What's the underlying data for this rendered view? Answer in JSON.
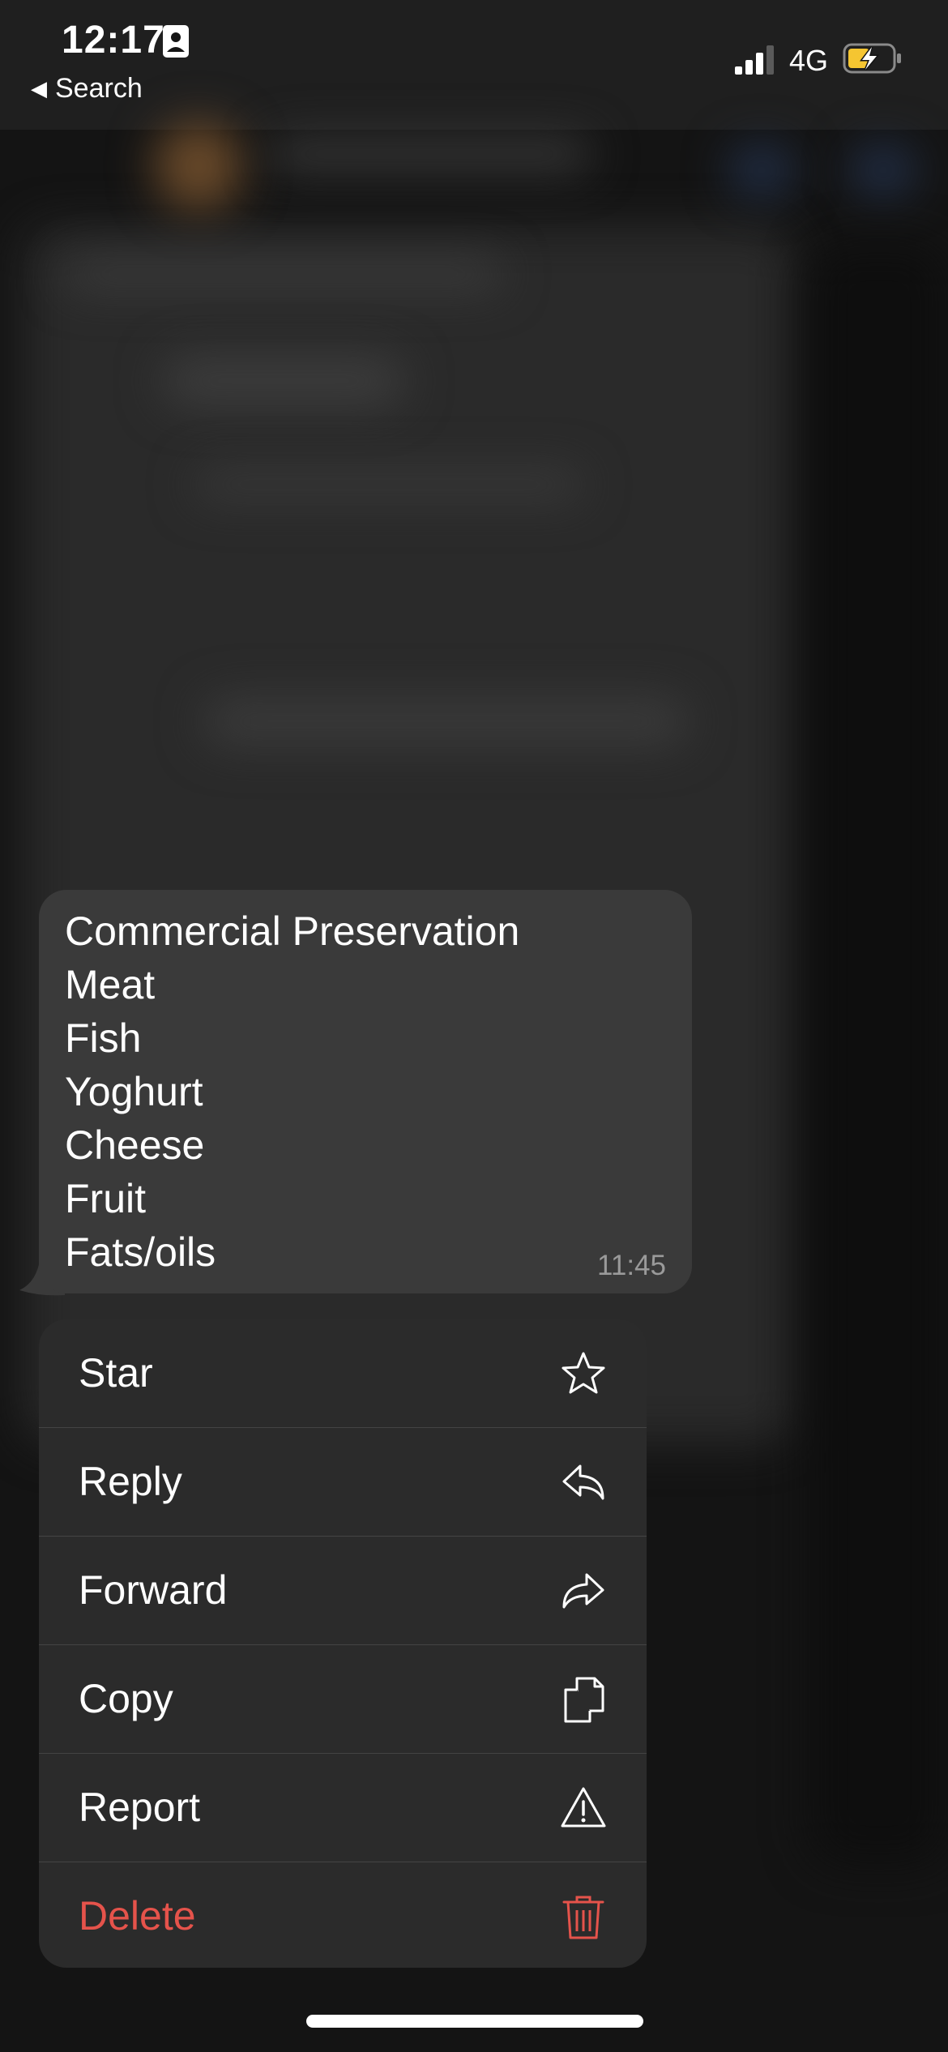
{
  "status_bar": {
    "time": "12:17",
    "back_label": "Search",
    "network": "4G"
  },
  "message": {
    "lines": [
      "Commercial Preservation",
      "Meat",
      "Fish",
      "Yoghurt",
      "Cheese",
      "Fruit",
      "Fats/oils"
    ],
    "time": "11:45"
  },
  "menu": {
    "items": [
      {
        "label": "Star",
        "icon": "star-icon"
      },
      {
        "label": "Reply",
        "icon": "reply-icon"
      },
      {
        "label": "Forward",
        "icon": "forward-icon"
      },
      {
        "label": "Copy",
        "icon": "copy-icon"
      },
      {
        "label": "Report",
        "icon": "warning-icon"
      },
      {
        "label": "Delete",
        "icon": "trash-icon",
        "color": "#e5534b"
      }
    ]
  }
}
